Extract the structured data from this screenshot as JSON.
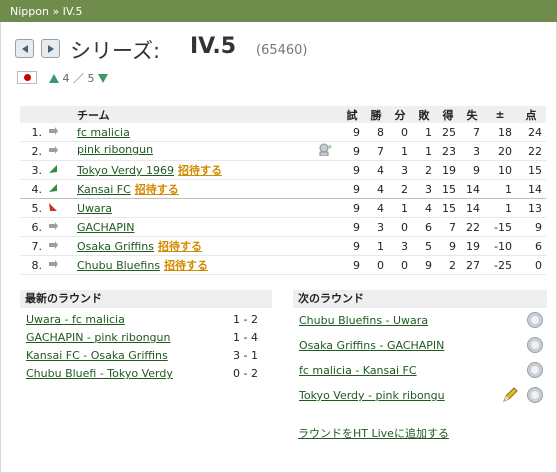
{
  "breadcrumb": "Nippon » IV.5",
  "series": {
    "label": "シリーズ:",
    "name": "IV.5",
    "id": "(65460)",
    "level_current": "4",
    "level_sep": "／",
    "level_total": "5"
  },
  "table": {
    "headers": {
      "team": "チーム",
      "played": "試",
      "won": "勝",
      "draw": "分",
      "lost": "敗",
      "gf": "得",
      "ga": "失",
      "diff": "±",
      "pts": "点"
    },
    "rows": [
      {
        "pos": "1.",
        "trend": "same",
        "team": "fc malicia",
        "invite": "",
        "played": "9",
        "won": "8",
        "draw": "0",
        "lost": "1",
        "gf": "25",
        "ga": "7",
        "diff": "18",
        "pts": "24"
      },
      {
        "pos": "2.",
        "trend": "same",
        "team": "pink ribongun",
        "invite": "",
        "icon": "manager-icon",
        "played": "9",
        "won": "7",
        "draw": "1",
        "lost": "1",
        "gf": "23",
        "ga": "3",
        "diff": "20",
        "pts": "22"
      },
      {
        "pos": "3.",
        "trend": "up",
        "team": "Tokyo Verdy 1969",
        "invite": "招待する",
        "played": "9",
        "won": "4",
        "draw": "3",
        "lost": "2",
        "gf": "19",
        "ga": "9",
        "diff": "10",
        "pts": "15"
      },
      {
        "pos": "4.",
        "trend": "up",
        "team": "Kansai FC",
        "invite": "招待する",
        "played": "9",
        "won": "4",
        "draw": "2",
        "lost": "3",
        "gf": "15",
        "ga": "14",
        "diff": "1",
        "pts": "14"
      },
      {
        "pos": "5.",
        "trend": "down",
        "team": "Uwara",
        "invite": "",
        "played": "9",
        "won": "4",
        "draw": "1",
        "lost": "4",
        "gf": "15",
        "ga": "14",
        "diff": "1",
        "pts": "13"
      },
      {
        "pos": "6.",
        "trend": "same",
        "team": "GACHAPIN",
        "invite": "",
        "played": "9",
        "won": "3",
        "draw": "0",
        "lost": "6",
        "gf": "7",
        "ga": "22",
        "diff": "-15",
        "pts": "9"
      },
      {
        "pos": "7.",
        "trend": "same",
        "team": "Osaka Griffins",
        "invite": "招待する",
        "played": "9",
        "won": "1",
        "draw": "3",
        "lost": "5",
        "gf": "9",
        "ga": "19",
        "diff": "-10",
        "pts": "6"
      },
      {
        "pos": "8.",
        "trend": "same",
        "team": "Chubu Bluefins",
        "invite": "招待する",
        "played": "9",
        "won": "0",
        "draw": "0",
        "lost": "9",
        "gf": "2",
        "ga": "27",
        "diff": "-25",
        "pts": "0"
      }
    ]
  },
  "latest": {
    "title": "最新のラウンド",
    "matches": [
      {
        "match": "Uwara - fc malicia",
        "score": "1 - 2"
      },
      {
        "match": "GACHAPIN - pink ribongun",
        "score": "1 - 4"
      },
      {
        "match": "Kansai FC - Osaka Griffins",
        "score": "3 - 1"
      },
      {
        "match": "Chubu Bluefi - Tokyo Verdy",
        "score": "0 - 2"
      }
    ]
  },
  "next": {
    "title": "次のラウンド",
    "matches": [
      {
        "match": "Chubu Bluefins - Uwara"
      },
      {
        "match": "Osaka Griffins - GACHAPIN"
      },
      {
        "match": "fc malicia - Kansai FC"
      },
      {
        "match": "Tokyo Verdy  - pink ribongu"
      }
    ],
    "add_link": "ラウンドをHT Liveに追加する"
  },
  "colors": {
    "header_bar": "#6f8c4d",
    "link": "#1f5a1f",
    "invite": "#d28a00",
    "trend_up": "#2f8f3f",
    "trend_down": "#c0392b",
    "trend_same": "#9aa0a6"
  }
}
